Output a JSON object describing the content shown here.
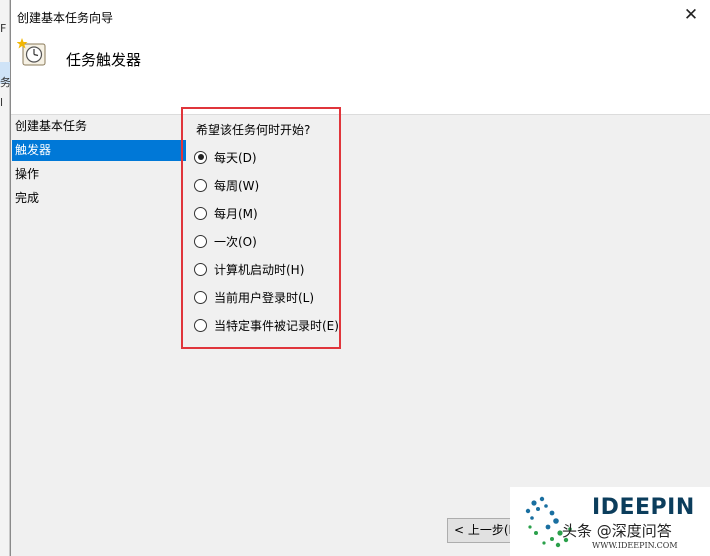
{
  "background_app": {
    "fragments": [
      "F",
      "务",
      "l"
    ]
  },
  "window": {
    "title": "创建基本任务向导",
    "close_glyph": "✕"
  },
  "header": {
    "title": "任务触发器",
    "icon": "task-clock-icon"
  },
  "nav": {
    "items": [
      {
        "label": "创建基本任务",
        "active": false
      },
      {
        "label": "触发器",
        "active": true
      },
      {
        "label": "操作",
        "active": false
      },
      {
        "label": "完成",
        "active": false
      }
    ]
  },
  "trigger": {
    "question": "希望该任务何时开始?",
    "options": [
      {
        "label": "每天(D)",
        "checked": true
      },
      {
        "label": "每周(W)",
        "checked": false
      },
      {
        "label": "每月(M)",
        "checked": false
      },
      {
        "label": "一次(O)",
        "checked": false
      },
      {
        "label": "计算机启动时(H)",
        "checked": false
      },
      {
        "label": "当前用户登录时(L)",
        "checked": false
      },
      {
        "label": "当特定事件被记录时(E)",
        "checked": false
      }
    ]
  },
  "buttons": {
    "back": "< 上一步(B)"
  },
  "watermark": {
    "brand": "IDEEPIN",
    "subtitle": "头条 @深度问答",
    "url": "WWW.IDEEPIN.COM"
  },
  "colors": {
    "accent": "#0078d7",
    "highlight": "#e0353b"
  }
}
